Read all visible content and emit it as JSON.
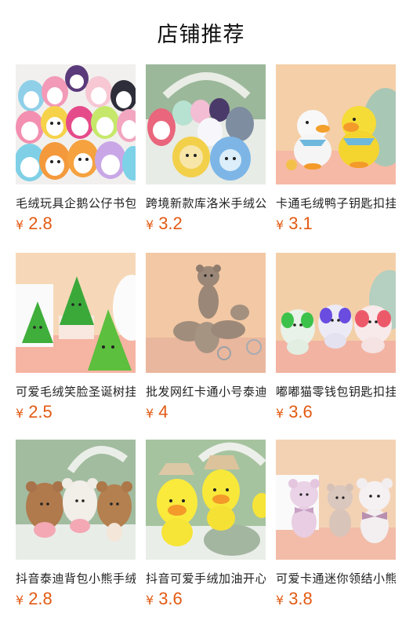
{
  "page_title": "店铺推荐",
  "currency_symbol": "¥",
  "products": [
    {
      "name": "毛绒玩具企鹅公仔书包挂件",
      "price": "2.8",
      "image": "penguin-plush-pile"
    },
    {
      "name": "跨境新款库洛米手绒公仔",
      "price": "3.2",
      "image": "sanrio-plush-group"
    },
    {
      "name": "卡通毛绒鸭子钥匙扣挂件",
      "price": "3.1",
      "image": "duck-plush-pair"
    },
    {
      "name": "可爱毛绒笑脸圣诞树挂件",
      "price": "2.5",
      "image": "christmas-tree-plush"
    },
    {
      "name": "批发网红卡通小号泰迪熊",
      "price": "4",
      "image": "teddy-bear-keychain"
    },
    {
      "name": "嘟嘟猫零钱包钥匙扣挂件",
      "price": "3.6",
      "image": "cat-coin-purse"
    },
    {
      "name": "抖音泰迪背包小熊手绒挂件",
      "price": "2.8",
      "image": "bear-backpack-plush"
    },
    {
      "name": "抖音可爱手绒加油开心鸭",
      "price": "3.6",
      "image": "yellow-duck-hat-plush"
    },
    {
      "name": "可爱卡通迷你领结小熊公仔",
      "price": "3.8",
      "image": "bowtie-bear-plush"
    }
  ],
  "colors": {
    "price": "#e25a13",
    "title": "#111111"
  }
}
